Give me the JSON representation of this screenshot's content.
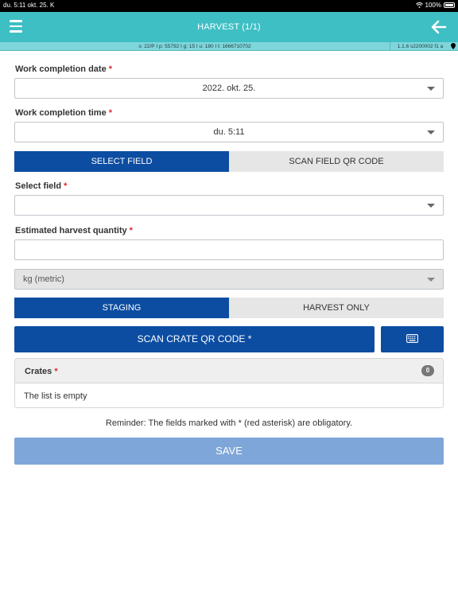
{
  "status_bar": {
    "time_date": "du. 5:11   okt. 25. K",
    "battery": "100%"
  },
  "header": {
    "title": "HARVEST (1/1)",
    "menu_icon": "hamburger-menu-icon",
    "back_icon": "arrow-left-icon",
    "color": "#3dbfc4"
  },
  "info_bar": {
    "session": "s: 22/P I p: 55792 I g: 15 I u: 180 I t: 1666710702",
    "version": "1.1.6 s2200002 f1 a"
  },
  "form": {
    "completion_date": {
      "label": "Work completion date",
      "required_mark": "*",
      "value": "2022. okt. 25."
    },
    "completion_time": {
      "label": "Work completion time",
      "required_mark": "*",
      "value": "du. 5:11"
    },
    "field_mode": {
      "options": [
        "SELECT FIELD",
        "SCAN FIELD QR CODE"
      ],
      "selected": "SELECT FIELD"
    },
    "select_field": {
      "label": "Select field",
      "required_mark": "*",
      "value": ""
    },
    "harvest_quantity": {
      "label": "Estimated harvest quantity",
      "required_mark": "*",
      "value": ""
    },
    "unit": {
      "value": "kg (metric)"
    },
    "harvest_mode": {
      "options": [
        "STAGING",
        "HARVEST ONLY"
      ],
      "selected": "STAGING"
    },
    "scan_crate_label": "SCAN CRATE QR CODE *",
    "crates": {
      "title": "Crates",
      "required_mark": "*",
      "count": "0",
      "empty_text": "The list is empty"
    },
    "reminder": "Reminder: The fields marked with * (red asterisk) are obligatory.",
    "save_label": "SAVE"
  },
  "colors": {
    "primary": "#0c4da2",
    "save_disabled": "#7fa6d8",
    "required": "#e02828"
  }
}
